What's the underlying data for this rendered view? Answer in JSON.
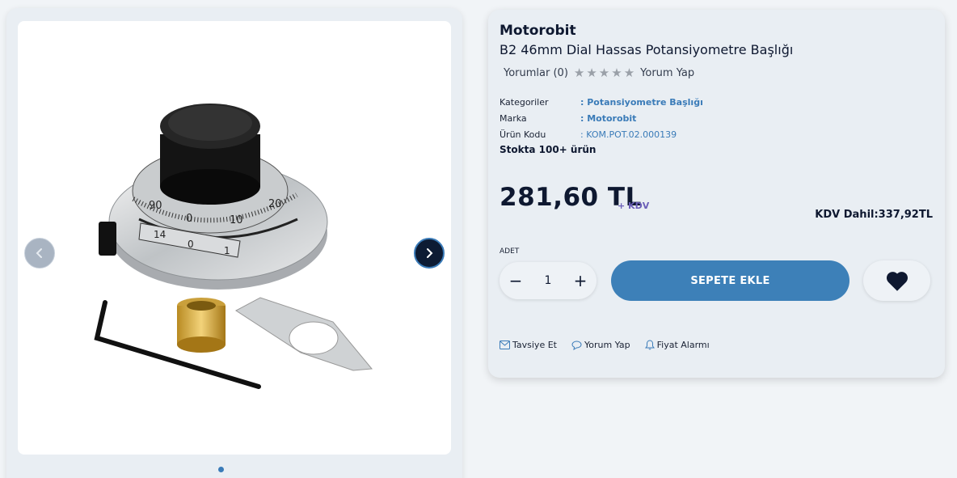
{
  "gallery": {
    "prev_icon": "chevron-left-icon",
    "next_icon": "chevron-right-icon",
    "active_slide": 1,
    "slides_count": 1
  },
  "product": {
    "brand": "Motorobit",
    "name": "B2 46mm Dial Hassas Potansiyometre Başlığı",
    "reviews_label": "Yorumlar (0)",
    "rating": 0,
    "rating_max": 5,
    "write_review": "Yorum Yap",
    "meta": {
      "category_key": "Kategoriler",
      "category_val": ": Potansiyometre Başlığı",
      "brand_key": "Marka",
      "brand_val": ": Motorobit",
      "code_key": "Ürün Kodu",
      "code_val": ": KOM.POT.02.000139"
    },
    "stock": "Stokta 100+ ürün",
    "price": "281,60 TL",
    "kdv_label": "+ KDV",
    "kdv_included": "KDV Dahil:337,92TL"
  },
  "cart": {
    "qty_label": "ADET",
    "minus": "−",
    "qty_value": "1",
    "plus": "+",
    "add_label": "SEPETE EKLE"
  },
  "actions": {
    "recommend": "Tavsiye Et",
    "review": "Yorum Yap",
    "price_alarm": "Fiyat Alarmı"
  },
  "colors": {
    "accent": "#3d80b8",
    "dark": "#0e1830",
    "kdv": "#6b5fb8"
  }
}
